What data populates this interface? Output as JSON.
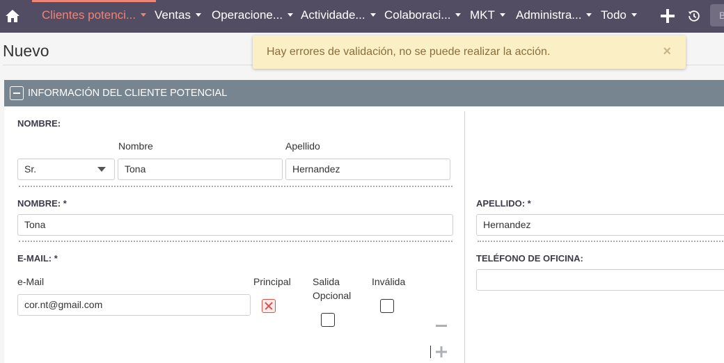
{
  "nav": {
    "items": [
      {
        "label": "Clientes potenci..."
      },
      {
        "label": "Ventas"
      },
      {
        "label": "Operacione..."
      },
      {
        "label": "Actividade..."
      },
      {
        "label": "Colaboraci..."
      },
      {
        "label": "MKT"
      },
      {
        "label": "Administra..."
      },
      {
        "label": "Todo"
      }
    ],
    "search_placeholder": "B",
    "accent_color": "#f08377",
    "bar_color": "#534d64"
  },
  "page": {
    "title": "Nuevo"
  },
  "alert": {
    "message": "Hay errores de validación, no se puede realizar la acción.",
    "close": "×"
  },
  "panel": {
    "title": "INFORMACIÓN DEL CLIENTE POTENCIAL",
    "nombre_group": {
      "label": "NOMBRE:",
      "salutation": "Sr.",
      "first_name_label": "Nombre",
      "first_name_value": "Tona",
      "last_name_label": "Apellido",
      "last_name_value": "Hernandez"
    },
    "nombre": {
      "label": "NOMBRE: *",
      "value": "Tona"
    },
    "apellido": {
      "label": "APELLIDO: *",
      "value": "Hernandez"
    },
    "email": {
      "label": "E-MAIL: *",
      "col_email": "e-Mail",
      "col_principal": "Principal",
      "col_optout_1": "Salida",
      "col_optout_2": "Opcional",
      "col_invalid": "Inválida",
      "value": "cor.nt@gmail.com",
      "principal_checked": true,
      "optout_checked": false,
      "invalid_checked": false
    },
    "telefono": {
      "label": "TELÉFONO DE OFICINA:",
      "value": ""
    }
  }
}
